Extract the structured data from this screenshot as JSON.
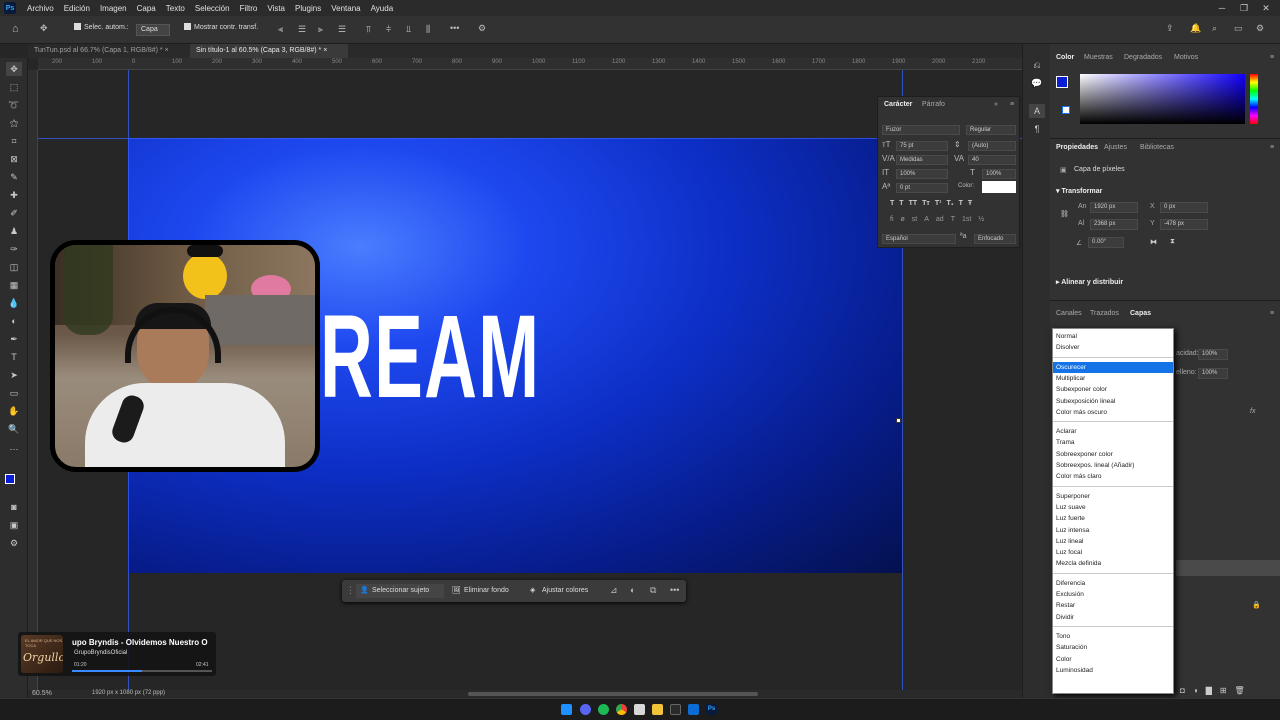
{
  "menubar": {
    "logo": "Ps",
    "items": [
      "Archivo",
      "Edición",
      "Imagen",
      "Capa",
      "Texto",
      "Selección",
      "Filtro",
      "Vista",
      "Plugins",
      "Ventana",
      "Ayuda"
    ]
  },
  "options": {
    "auto_select_label": "Selec. autom.:",
    "auto_select_value": "Capa",
    "show_transform_label": "Mostrar contr. transf."
  },
  "tabs": [
    {
      "label": "TunTun.psd al 66.7% (Capa 1, RGB/8#) *"
    },
    {
      "label": "Sin título-1 al 60.5% (Capa 3, RGB/8#) *"
    }
  ],
  "ruler": {
    "ticks": [
      "200",
      "100",
      "0",
      "100",
      "200",
      "300",
      "400",
      "500",
      "600",
      "700",
      "800",
      "900",
      "1000",
      "1100",
      "1200",
      "1300",
      "1400",
      "1500",
      "1600",
      "1700",
      "1800",
      "1900",
      "2000",
      "2100"
    ]
  },
  "canvas": {
    "text": "REAM"
  },
  "context_bar": {
    "select_subject": "Seleccionar sujeto",
    "remove_bg": "Eliminar fondo",
    "adjust_colors": "Ajustar colores"
  },
  "character_panel": {
    "tab_character": "Carácter",
    "tab_paragraph": "Párrafo",
    "font": "Fuzor",
    "style": "Regular",
    "size": "75 pt",
    "leading": "(Auto)",
    "kerning": "Medidas",
    "tracking": "40",
    "v_scale": "100%",
    "h_scale": "100%",
    "baseline": "0 pt",
    "color_label": "Color:",
    "language": "Español",
    "antialias": "Enfocado"
  },
  "right_panels": {
    "color_tabs": [
      "Color",
      "Muestras",
      "Degradados",
      "Motivos"
    ],
    "props_tabs": [
      "Propiedades",
      "Ajustes",
      "Bibliotecas"
    ],
    "layer_type": "Capa de píxeles",
    "transform_label": "Transformar",
    "width_label": "An",
    "width_value": "1920 px",
    "height_label": "Al",
    "height_value": "2368 px",
    "x_label": "X",
    "x_value": "0 px",
    "y_label": "Y",
    "y_value": "-478 px",
    "angle_value": "0.00°",
    "align_label": "Alinear y distribuir",
    "layers_tabs": [
      "Canales",
      "Trazados",
      "Capas"
    ],
    "opacity_label": "acidad:",
    "opacity_value": "100%",
    "fill_label": "elleno:",
    "fill_value": "100%",
    "fx_label": "fx"
  },
  "blend_menu": {
    "groups": [
      [
        "Normal",
        "Disolver"
      ],
      [
        "Oscurecer",
        "Multiplicar",
        "Subexponer color",
        "Subexposición lineal",
        "Color más oscuro"
      ],
      [
        "Aclarar",
        "Trama",
        "Sobreexponer color",
        "Sobreexpos. lineal (Añadir)",
        "Color más claro"
      ],
      [
        "Superponer",
        "Luz suave",
        "Luz fuerte",
        "Luz intensa",
        "Luz lineal",
        "Luz focal",
        "Mezcla definida"
      ],
      [
        "Diferencia",
        "Exclusión",
        "Restar",
        "Dividir"
      ],
      [
        "Tono",
        "Saturación",
        "Color",
        "Luminosidad"
      ]
    ],
    "selected": "Oscurecer"
  },
  "status": {
    "zoom": "60.5%",
    "doc_info": "1920 px x 1080 px (72 ppp)"
  },
  "media": {
    "title": "upo Bryndis - Olvidemos Nuestro O",
    "artist": "GrupoBryndisOficial",
    "elapsed": "01:20",
    "duration": "02:41",
    "progress": 0.5,
    "thumb_text": "Orgullo",
    "thumb_small": "EL AMOR QUE NOS TOCA"
  },
  "colors": {
    "accent": "#1473e6",
    "foreground": "#0a1ed6",
    "background": "#ffffff"
  }
}
